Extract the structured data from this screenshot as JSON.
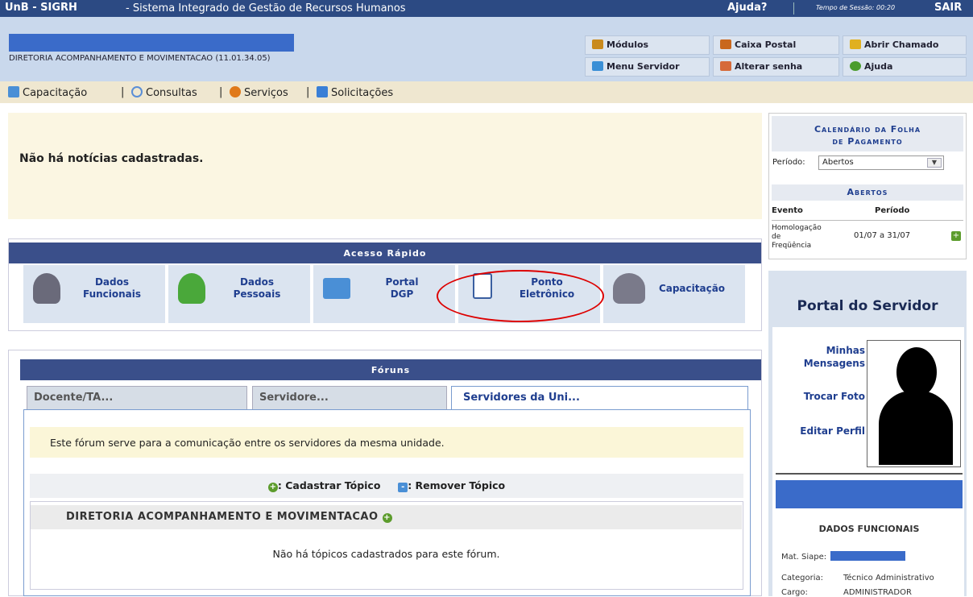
{
  "header": {
    "logo": "UnB - SIGRH",
    "system": "- Sistema Integrado de Gestão de Recursos Humanos",
    "help": "Ajuda?",
    "session": "Tempo de Sessão: 00:20",
    "logout": "SAIR"
  },
  "user": {
    "unit": "DIRETORIA ACOMPANHAMENTO E MOVIMENTACAO (11.01.34.05)"
  },
  "toolbar": {
    "modulos": "Módulos",
    "caixa": "Caixa Postal",
    "chamado": "Abrir Chamado",
    "menu_servidor": "Menu Servidor",
    "senha": "Alterar senha",
    "ajuda": "Ajuda"
  },
  "menu": {
    "capacitacao": "Capacitação",
    "consultas": "Consultas",
    "servicos": "Serviços",
    "solicitacoes": "Solicitações",
    "sep": "|"
  },
  "news": {
    "message": "Não há notícias cadastradas."
  },
  "quick_access": {
    "title": "Acesso Rápido",
    "items": [
      {
        "l1": "Dados",
        "l2": "Funcionais"
      },
      {
        "l1": "Dados",
        "l2": "Pessoais"
      },
      {
        "l1": "Portal",
        "l2": "DGP"
      },
      {
        "l1": "Ponto",
        "l2": "Eletrônico"
      },
      {
        "l1": "Capacitação",
        "l2": ""
      }
    ]
  },
  "forums": {
    "title": "Fóruns",
    "tabs": [
      "Docente/TA...",
      "Servidore...",
      "Servidores da Uni..."
    ],
    "description": "Este fórum serve para a comunicação entre os servidores da mesma unidade.",
    "add_topic": ": Cadastrar Tópico",
    "remove_topic": ": Remover Tópico",
    "unit_title": "DIRETORIA ACOMPANHAMENTO E MOVIMENTACAO",
    "no_topics": "Não há tópicos cadastrados para este fórum."
  },
  "calendar": {
    "title_l1": "Calendário da Folha",
    "title_l2": "de Pagamento",
    "period_label": "Período:",
    "period_value": "Abertos",
    "sub": "Abertos",
    "col_event": "Evento",
    "col_period": "Período",
    "event": "Homologação de Freqüência",
    "event_period": "01/07 a 31/07"
  },
  "portal": {
    "title": "Portal do Servidor",
    "msgs_l1": "Minhas",
    "msgs_l2": "Mensagens",
    "photo": "Trocar Foto",
    "profile": "Editar Perfil",
    "dados_title": "DADOS FUNCIONAIS",
    "siape_label": "Mat. Siape:",
    "cat_label": "Categoria:",
    "cat_value": "Técnico Administrativo",
    "cargo_label": "Cargo:",
    "cargo_value": "ADMINISTRADOR"
  },
  "colors": {
    "header": "#2c4a83",
    "accent": "#1f3e8f",
    "highlight": "#d00000"
  }
}
